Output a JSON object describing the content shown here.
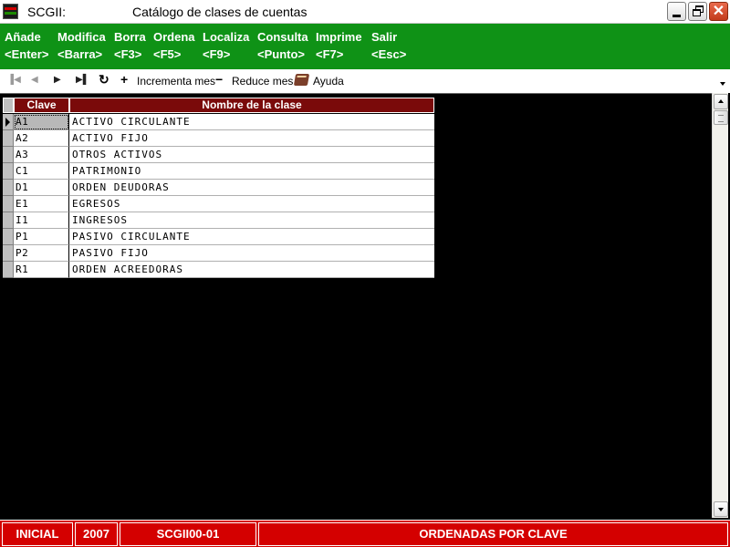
{
  "window": {
    "app_title": "SCGII:",
    "caption": "Catálogo de clases de cuentas"
  },
  "menu": [
    {
      "label": "Añade",
      "shortcut": "<Enter>"
    },
    {
      "label": "Modifica",
      "shortcut": "<Barra>"
    },
    {
      "label": "Borra",
      "shortcut": "<F3>"
    },
    {
      "label": "Ordena",
      "shortcut": "<F5>"
    },
    {
      "label": "Localiza",
      "shortcut": "<F9>"
    },
    {
      "label": "Consulta",
      "shortcut": "<Punto>"
    },
    {
      "label": "Imprime",
      "shortcut": "<F7>"
    },
    {
      "label": "Salir",
      "shortcut": "<Esc>"
    }
  ],
  "toolbar": {
    "first_icon": "▐◀",
    "prev_icon": "◀",
    "next_icon": "▶",
    "last_icon": "▶▌",
    "refresh_icon": "↻",
    "increment_icon": "+",
    "increment_label": "Incrementa mes",
    "reduce_icon": "−",
    "reduce_label": "Reduce mes",
    "help_label": "Ayuda"
  },
  "grid": {
    "columns": [
      "Clave",
      "Nombre de la clase"
    ],
    "rows": [
      {
        "clave": "A1",
        "nombre": "ACTIVO CIRCULANTE",
        "selected": true
      },
      {
        "clave": "A2",
        "nombre": "ACTIVO FIJO"
      },
      {
        "clave": "A3",
        "nombre": "OTROS ACTIVOS"
      },
      {
        "clave": "C1",
        "nombre": "PATRIMONIO"
      },
      {
        "clave": "D1",
        "nombre": "ORDEN DEUDORAS"
      },
      {
        "clave": "E1",
        "nombre": "EGRESOS"
      },
      {
        "clave": "I1",
        "nombre": "INGRESOS"
      },
      {
        "clave": "P1",
        "nombre": "PASIVO CIRCULANTE"
      },
      {
        "clave": "P2",
        "nombre": "PASIVO FIJO"
      },
      {
        "clave": "R1",
        "nombre": "ORDEN ACREEDORAS"
      }
    ]
  },
  "status": {
    "mode": "INICIAL",
    "year": "2007",
    "module": "SCGII00-01",
    "message": "ORDENADAS POR CLAVE"
  },
  "colors": {
    "menubar": "#0f9216",
    "header": "#7a0a0a",
    "statusbar": "#d40000"
  }
}
